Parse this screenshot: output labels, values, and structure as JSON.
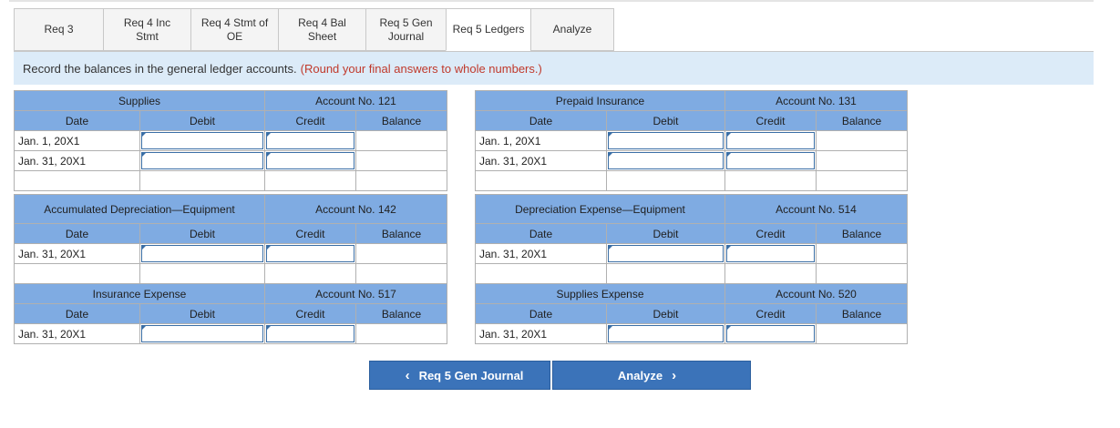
{
  "tabs": [
    {
      "label": "Req 3",
      "active": false
    },
    {
      "label": "Req 4 Inc\nStmt",
      "active": false
    },
    {
      "label": "Req 4 Stmt of\nOE",
      "active": false
    },
    {
      "label": "Req 4 Bal\nSheet",
      "active": false
    },
    {
      "label": "Req 5 Gen\nJournal",
      "active": false
    },
    {
      "label": "Req 5 Ledgers",
      "active": true
    },
    {
      "label": "Analyze",
      "active": false
    }
  ],
  "instruction": {
    "text": "Record the balances in the general ledger accounts.",
    "note": "(Round your final answers to whole numbers.)"
  },
  "col_headers": {
    "date": "Date",
    "debit": "Debit",
    "credit": "Credit",
    "balance": "Balance"
  },
  "accounts": {
    "supplies": {
      "name": "Supplies",
      "number": "Account No. 121",
      "rows": [
        "Jan. 1, 20X1",
        "Jan. 31, 20X1"
      ]
    },
    "prepaid_insurance": {
      "name": "Prepaid Insurance",
      "number": "Account No. 131",
      "rows": [
        "Jan. 1, 20X1",
        "Jan. 31, 20X1"
      ]
    },
    "accum_dep": {
      "name": "Accumulated Depreciation—Equipment",
      "number": "Account No. 142",
      "rows": [
        "Jan. 31, 20X1"
      ]
    },
    "dep_expense": {
      "name": "Depreciation Expense—Equipment",
      "number": "Account No. 514",
      "rows": [
        "Jan. 31, 20X1"
      ]
    },
    "insurance_expense": {
      "name": "Insurance Expense",
      "number": "Account No. 517",
      "rows": [
        "Jan. 31, 20X1"
      ]
    },
    "supplies_expense": {
      "name": "Supplies Expense",
      "number": "Account No. 520",
      "rows": [
        "Jan. 31, 20X1"
      ]
    }
  },
  "nav": {
    "prev": "Req 5 Gen Journal",
    "next": "Analyze"
  },
  "colors": {
    "header": "#7fabe2",
    "button": "#3b73b9",
    "instruction_bg": "#dcebf8",
    "note": "#c0392b"
  }
}
